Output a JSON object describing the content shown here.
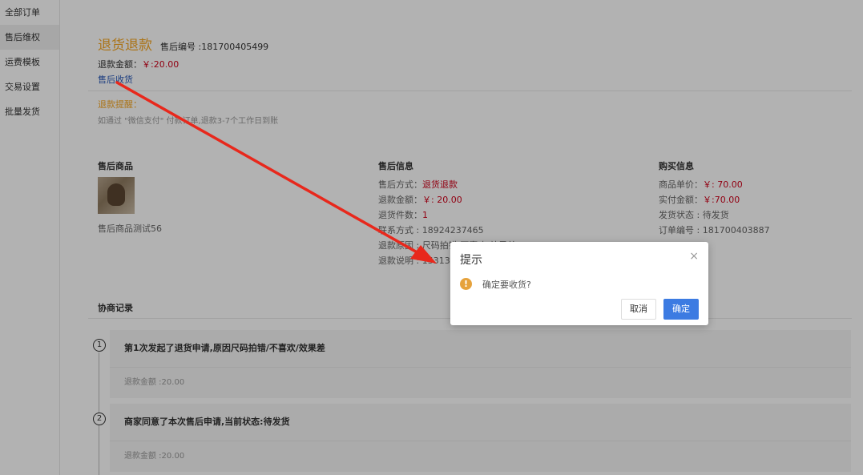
{
  "sidebar": {
    "items": [
      {
        "label": "全部订单"
      },
      {
        "label": "售后维权"
      },
      {
        "label": "运费模板"
      },
      {
        "label": "交易设置"
      },
      {
        "label": "批量发货"
      }
    ]
  },
  "header": {
    "title": "退货退款",
    "sub_label": "售后编号 :181700405499",
    "refund_label": "退款金额：",
    "refund_value": "￥:20.00",
    "receipt_link": "售后收货"
  },
  "tips": {
    "title": "退款提醒：",
    "text": "如通过 \"微信支付\" 付款订单,退款3-7个工作日到账"
  },
  "goods": {
    "title": "售后商品",
    "caption": "售后商品测试56"
  },
  "after_sale_info": {
    "title": "售后信息",
    "method_label": "售后方式：",
    "method_value": "退货退款",
    "amount_label": "退款金额：",
    "amount_value": "￥: 20.00",
    "count_label": "退货件数：",
    "count_value": "1",
    "contact_line": "联系方式 : 18924237465",
    "reason_line": "退款原因 : 尺码拍错/不喜欢/效果差",
    "note_line": "退款说明 : 153132"
  },
  "purchase_info": {
    "title": "购买信息",
    "unit_label": "商品单价：",
    "unit_value": "￥: 70.00",
    "paid_label": "实付金额：",
    "paid_value": "￥:70.00",
    "ship_line": "发货状态 : 待发货",
    "order_line": "订单编号 : 181700403887"
  },
  "negotiation": {
    "title": "协商记录",
    "steps": [
      {
        "num": "1",
        "head": "第1次发起了退货申请,原因尺码拍错/不喜欢/效果差",
        "body": "退款金额 :20.00"
      },
      {
        "num": "2",
        "head": "商家同意了本次售后申请,当前状态:待发货",
        "body": "退款金额 :20.00"
      }
    ]
  },
  "dialog": {
    "title": "提示",
    "close": "×",
    "icon_glyph": "!",
    "message": "确定要收货?",
    "cancel": "取消",
    "ok": "确定"
  },
  "colors": {
    "accent_orange": "#f5a623",
    "price_red": "#d0021b",
    "primary_blue": "#3c7be2",
    "arrow_red": "#e8281c"
  }
}
